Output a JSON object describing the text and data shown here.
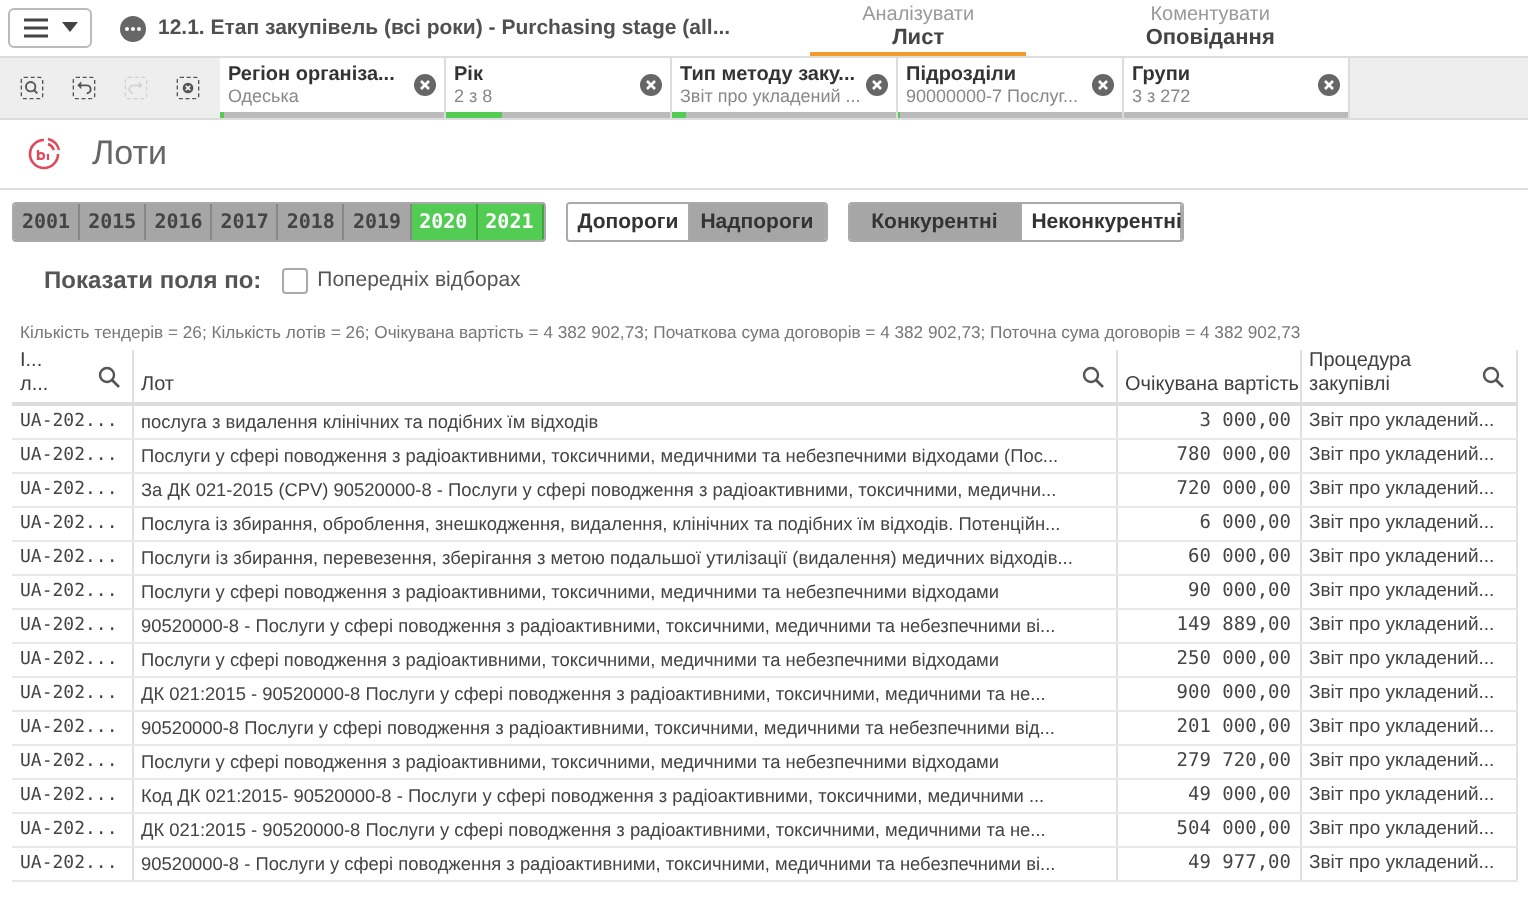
{
  "topbar": {
    "app_title": "12.1. Етап закупівель (всі роки) - Purchasing stage (all...",
    "tabs": [
      {
        "caption": "Аналізувати",
        "label": "Лист",
        "selected": true
      },
      {
        "caption": "Коментувати",
        "label": "Оповідання",
        "selected": false
      }
    ]
  },
  "toolbar": {
    "tools": [
      {
        "kind": "search",
        "disabled": false
      },
      {
        "kind": "back",
        "disabled": false
      },
      {
        "kind": "forward",
        "disabled": true
      },
      {
        "kind": "clear",
        "disabled": false
      }
    ]
  },
  "filters": [
    {
      "name": "Регіон організа...",
      "value": "Одеська",
      "level": 0.02
    },
    {
      "name": "Рік",
      "value": "2 з 8",
      "level": 0.25
    },
    {
      "name": "Тип методу заку...",
      "value": "Звіт про укладений ...",
      "level": 0.06
    },
    {
      "name": "Підрозділи",
      "value": "90000000-7 Послуг...",
      "level": 0.01
    },
    {
      "name": "Групи",
      "value": "3 з 272",
      "level": 0
    }
  ],
  "sheet_title": "Лоти",
  "years": [
    {
      "label": "2001",
      "selected": false
    },
    {
      "label": "2015",
      "selected": false
    },
    {
      "label": "2016",
      "selected": false
    },
    {
      "label": "2017",
      "selected": false
    },
    {
      "label": "2018",
      "selected": false
    },
    {
      "label": "2019",
      "selected": false
    },
    {
      "label": "2020",
      "selected": true
    },
    {
      "label": "2021",
      "selected": true
    }
  ],
  "thresholds": [
    {
      "label": "Допороги",
      "selected": true
    },
    {
      "label": "Надпороги",
      "selected": false
    }
  ],
  "competition": [
    {
      "label": "Конкурентні",
      "selected": false
    },
    {
      "label": "Неконкурентні",
      "selected": true
    }
  ],
  "show_fields": {
    "label": "Показати поля по:",
    "option": "Попередніх відборах",
    "checked": false
  },
  "summary": "Кількість тендерів = 26; Кількість лотів = 26; Очікувана вартість = 4 382 902,73; Початкова сума договорів = 4 382 902,73; Поточна сума договорів = 4 382 902,73",
  "table": {
    "columns": [
      {
        "label": "І...",
        "label2": "л...",
        "search": true
      },
      {
        "label": "Лот",
        "search": true
      },
      {
        "label": "Очікувана вартість",
        "search": false
      },
      {
        "label": "Процедура",
        "label2": "закупівлі",
        "search": true
      }
    ],
    "rows": [
      [
        "UA-202...",
        "послуга з видалення клінічних та подібних їм відходів",
        "3 000,00",
        "Звіт про укладений..."
      ],
      [
        "UA-202...",
        "Послуги у сфері поводження з радіоактивними, токсичними, медичними та небезпечними відходами (Пос...",
        "780 000,00",
        "Звіт про укладений..."
      ],
      [
        "UA-202...",
        "За ДК 021-2015 (CPV) 90520000-8 - Послуги у сфері поводження з радіоактивними, токсичними, медични...",
        "720 000,00",
        "Звіт про укладений..."
      ],
      [
        "UA-202...",
        "Послуга із збирання, оброблення, знешкодження, видалення, клінічних та подібних їм відходів. Потенційн...",
        "6 000,00",
        "Звіт про укладений..."
      ],
      [
        "UA-202...",
        "Послуги із збирання, перевезення, зберігання з метою подальшої утилізації (видалення) медичних відходів...",
        "60 000,00",
        "Звіт про укладений..."
      ],
      [
        "UA-202...",
        "Послуги у сфері поводження з радіоактивними, токсичними, медичними та небезпечними відходами",
        "90 000,00",
        "Звіт про укладений..."
      ],
      [
        "UA-202...",
        "90520000-8 - Послуги у сфері поводження з радіоактивними, токсичними, медичними та небезпечними ві...",
        "149 889,00",
        "Звіт про укладений..."
      ],
      [
        "UA-202...",
        "Послуги у сфері поводження з радіоактивними, токсичними, медичними та небезпечними відходами",
        "250 000,00",
        "Звіт про укладений..."
      ],
      [
        "UA-202...",
        "ДК 021:2015 - 90520000-8 Послуги у сфері поводження з радіоактивними, токсичними, медичними та не...",
        "900 000,00",
        "Звіт про укладений..."
      ],
      [
        "UA-202...",
        "90520000-8 Послуги у сфері поводження з радіоактивними, токсичними, медичними та небезпечними від...",
        "201 000,00",
        "Звіт про укладений..."
      ],
      [
        "UA-202...",
        "Послуги у сфері поводження з радіоактивними, токсичними, медичними та небезпечними відходами",
        "279 720,00",
        "Звіт про укладений..."
      ],
      [
        "UA-202...",
        "Код ДК 021:2015- 90520000-8 - Послуги у сфері поводження з радіоактивними, токсичними, медичними ...",
        "49 000,00",
        "Звіт про укладений..."
      ],
      [
        "UA-202...",
        "ДК 021:2015 - 90520000-8 Послуги у сфері поводження з радіоактивними, токсичними, медичними та не...",
        "504 000,00",
        "Звіт про укладений..."
      ],
      [
        "UA-202...",
        "90520000-8 - Послуги у сфері поводження з радіоактивними, токсичними, медичними та небезпечними ві...",
        "49 977,00",
        "Звіт про укладений..."
      ]
    ]
  }
}
